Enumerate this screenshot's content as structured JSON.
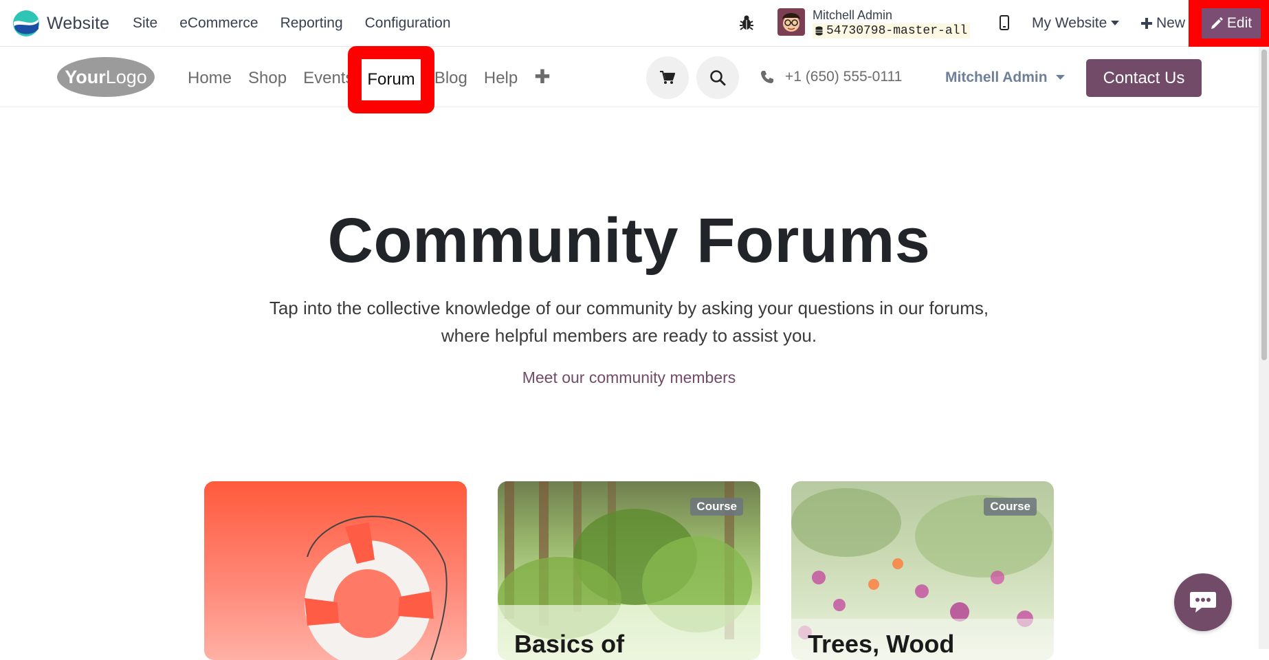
{
  "topbar": {
    "app_name": "Website",
    "menu": [
      "Site",
      "eCommerce",
      "Reporting",
      "Configuration"
    ],
    "user_name": "Mitchell Admin",
    "db_name": "54730798-master-all",
    "website_selector": "My Website",
    "new_label": "New",
    "edit_label": "Edit"
  },
  "sitenav": {
    "logo_text": "YourLogo",
    "links": [
      "Home",
      "Shop",
      "Events",
      "Forum",
      "Blog",
      "Help"
    ],
    "active_link": "Forum",
    "phone": "+1 (650) 555-0111",
    "user_dropdown": "Mitchell Admin",
    "contact_label": "Contact Us"
  },
  "hero": {
    "title": "Community Forums",
    "subtitle_line1": "Tap into the collective knowledge of our community by asking your questions in our forums,",
    "subtitle_line2": "where helpful members are ready to assist you.",
    "link": "Meet our community members"
  },
  "cards": [
    {
      "badge": "",
      "title": ""
    },
    {
      "badge": "Course",
      "title": "Basics of"
    },
    {
      "badge": "Course",
      "title": "Trees, Wood"
    }
  ],
  "colors": {
    "brand_purple": "#714b67",
    "highlight_red": "#ff0000",
    "edit_purple": "#7b4d72"
  }
}
